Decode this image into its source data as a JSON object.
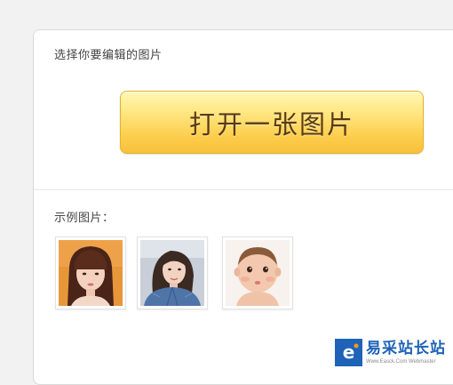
{
  "editor": {
    "section_title": "选择你要编辑的图片",
    "open_button_label": "打开一张图片",
    "examples_label": "示例图片："
  },
  "examples": [
    {
      "name": "sample-photo-woman-bangs"
    },
    {
      "name": "sample-photo-woman-denim"
    },
    {
      "name": "sample-photo-baby"
    }
  ],
  "watermark": {
    "title": "易采站长站",
    "subtitle": "Www.Easck.Com Webmaster"
  },
  "colors": {
    "button_top": "#fff8b6",
    "button_bottom": "#f8c03c",
    "button_text": "#5a3a12",
    "watermark_blue": "#1e63b8"
  }
}
